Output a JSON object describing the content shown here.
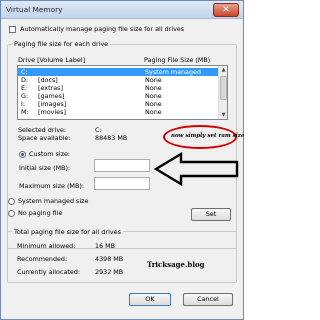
{
  "window": {
    "title": "Virtual Memory",
    "close_glyph": "✕"
  },
  "auto_manage": {
    "label": "Automatically manage paging file size for all drives",
    "checked": false
  },
  "paging_group": {
    "label": "Paging file size for each drive",
    "col_drive": "Drive  [Volume Label]",
    "col_size": "Paging File Size (MB)",
    "rows": [
      {
        "drive": "C:",
        "label": "",
        "size": "System managed",
        "selected": true
      },
      {
        "drive": "D:",
        "label": "[docs]",
        "size": "None"
      },
      {
        "drive": "E:",
        "label": "[extras]",
        "size": "None"
      },
      {
        "drive": "G:",
        "label": "[games]",
        "size": "None"
      },
      {
        "drive": "I:",
        "label": "[images]",
        "size": "None"
      },
      {
        "drive": "M:",
        "label": "[movies]",
        "size": "None"
      }
    ],
    "selected_drive_label": "Selected drive:",
    "selected_drive_value": "C:",
    "space_label": "Space available:",
    "space_value": "88483 MB",
    "custom_label": "Custom size:",
    "initial_label": "Initial size (MB):",
    "initial_value": "",
    "max_label": "Maximum size (MB):",
    "max_value": "",
    "system_managed_label": "System managed size",
    "no_paging_label": "No paging file",
    "selected_option": "custom",
    "set_label": "Set"
  },
  "total_group": {
    "label": "Total paging file size for all drives",
    "min_label": "Minimum allowed:",
    "min_value": "16 MB",
    "rec_label": "Recommended:",
    "rec_value": "4398 MB",
    "cur_label": "Currently allocated:",
    "cur_value": "2932 MB"
  },
  "buttons": {
    "ok": "OK",
    "cancel": "Cancel"
  },
  "annotation": {
    "text": "now simply  set ram size",
    "color": "#d40000"
  },
  "watermark": "Tricksage.blog"
}
